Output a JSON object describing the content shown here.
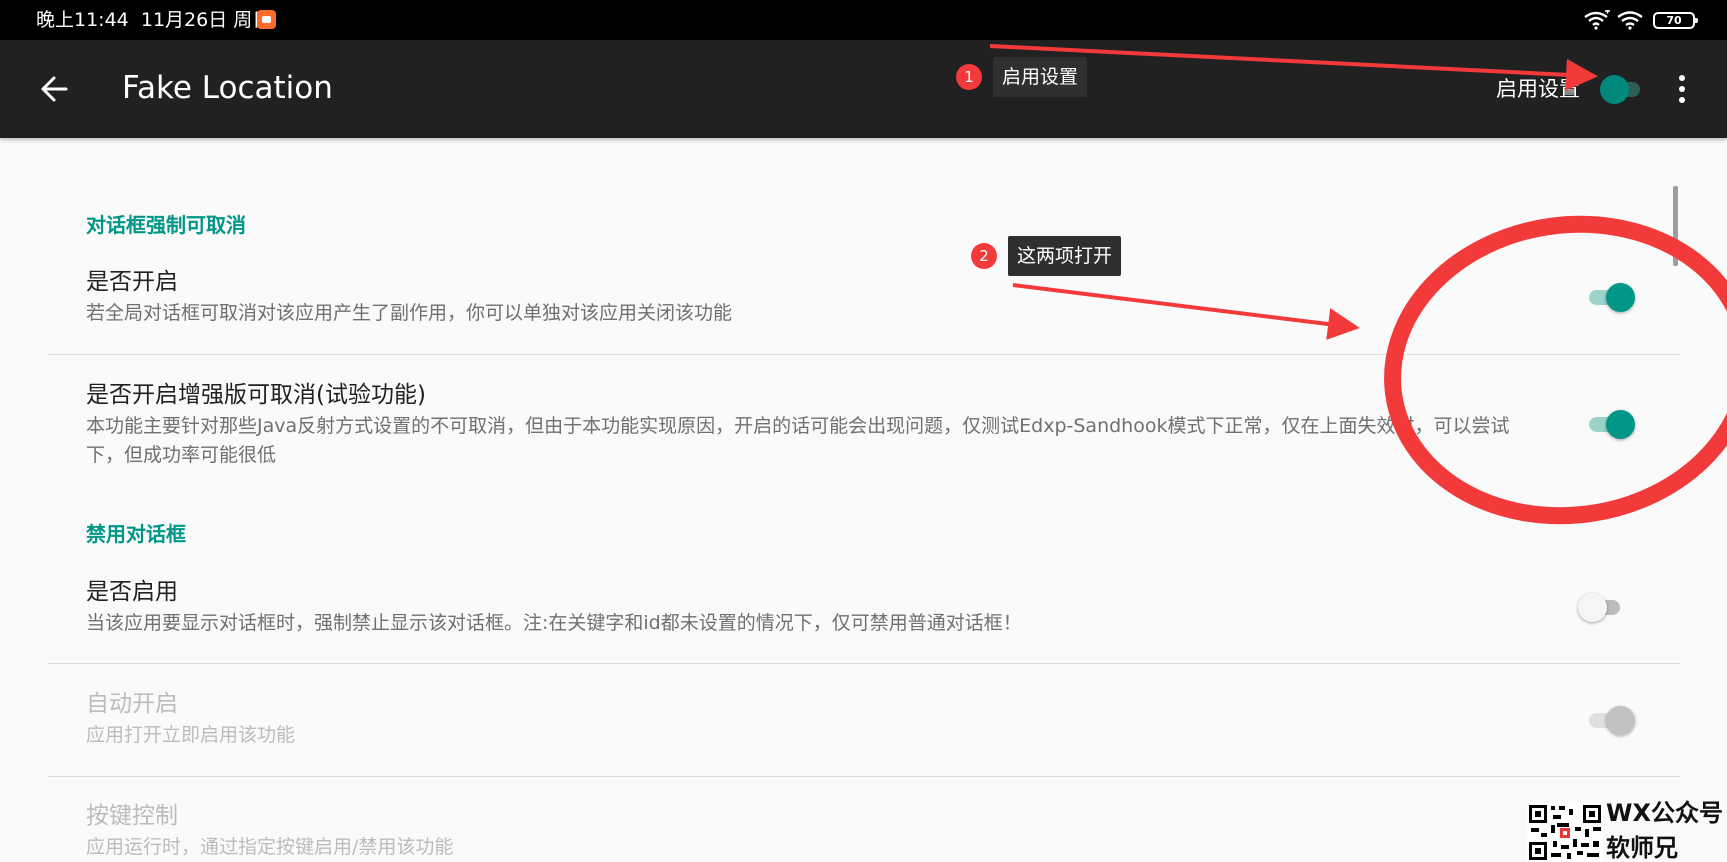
{
  "status_bar": {
    "time": "晚上11:44",
    "date": "11月26日 周日",
    "app_icon": "screen-recorder-icon",
    "wifi_icons": [
      "wifi-6-icon",
      "wifi-icon"
    ],
    "battery": "70"
  },
  "app_bar": {
    "back_icon": "arrow-left-icon",
    "title": "Fake Location",
    "enable_label": "启用设置",
    "enable_switch_on": true,
    "more_icon": "more-vertical-icon"
  },
  "sections": [
    {
      "header": "对话框强制可取消",
      "items": [
        {
          "title": "是否开启",
          "summary": "若全局对话框可取消对该应用产生了副作用，你可以单独对该应用关闭该功能",
          "checked": true,
          "enabled": true
        },
        {
          "title": "是否开启增强版可取消(试验功能)",
          "summary": "本功能主要针对那些Java反射方式设置的不可取消，但由于本功能实现原因，开启的话可能会出现问题，仅测试Edxp-Sandhook模式下正常，仅在上面失效时，可以尝试下，但成功率可能很低",
          "checked": true,
          "enabled": true
        }
      ]
    },
    {
      "header": "禁用对话框",
      "items": [
        {
          "title": "是否启用",
          "summary": "当该应用要显示对话框时，强制禁止显示该对话框。注:在关键字和id都未设置的情况下，仅可禁用普通对话框！",
          "checked": false,
          "enabled": true
        },
        {
          "title": "自动开启",
          "summary": "应用打开立即启用该功能",
          "checked": true,
          "enabled": false
        },
        {
          "title": "按键控制",
          "summary": "应用运行时，通过指定按键启用/禁用该功能",
          "checked": false,
          "enabled": false
        }
      ]
    }
  ],
  "annotations": [
    {
      "number": "1",
      "text": "启用设置"
    },
    {
      "number": "2",
      "text": "这两项打开"
    }
  ],
  "annotation_color": "#f23a3a",
  "accent_color": "#009688",
  "watermark": {
    "icon": "qr-code-icon",
    "line1": "WX公众号",
    "line2": "软师兄"
  }
}
